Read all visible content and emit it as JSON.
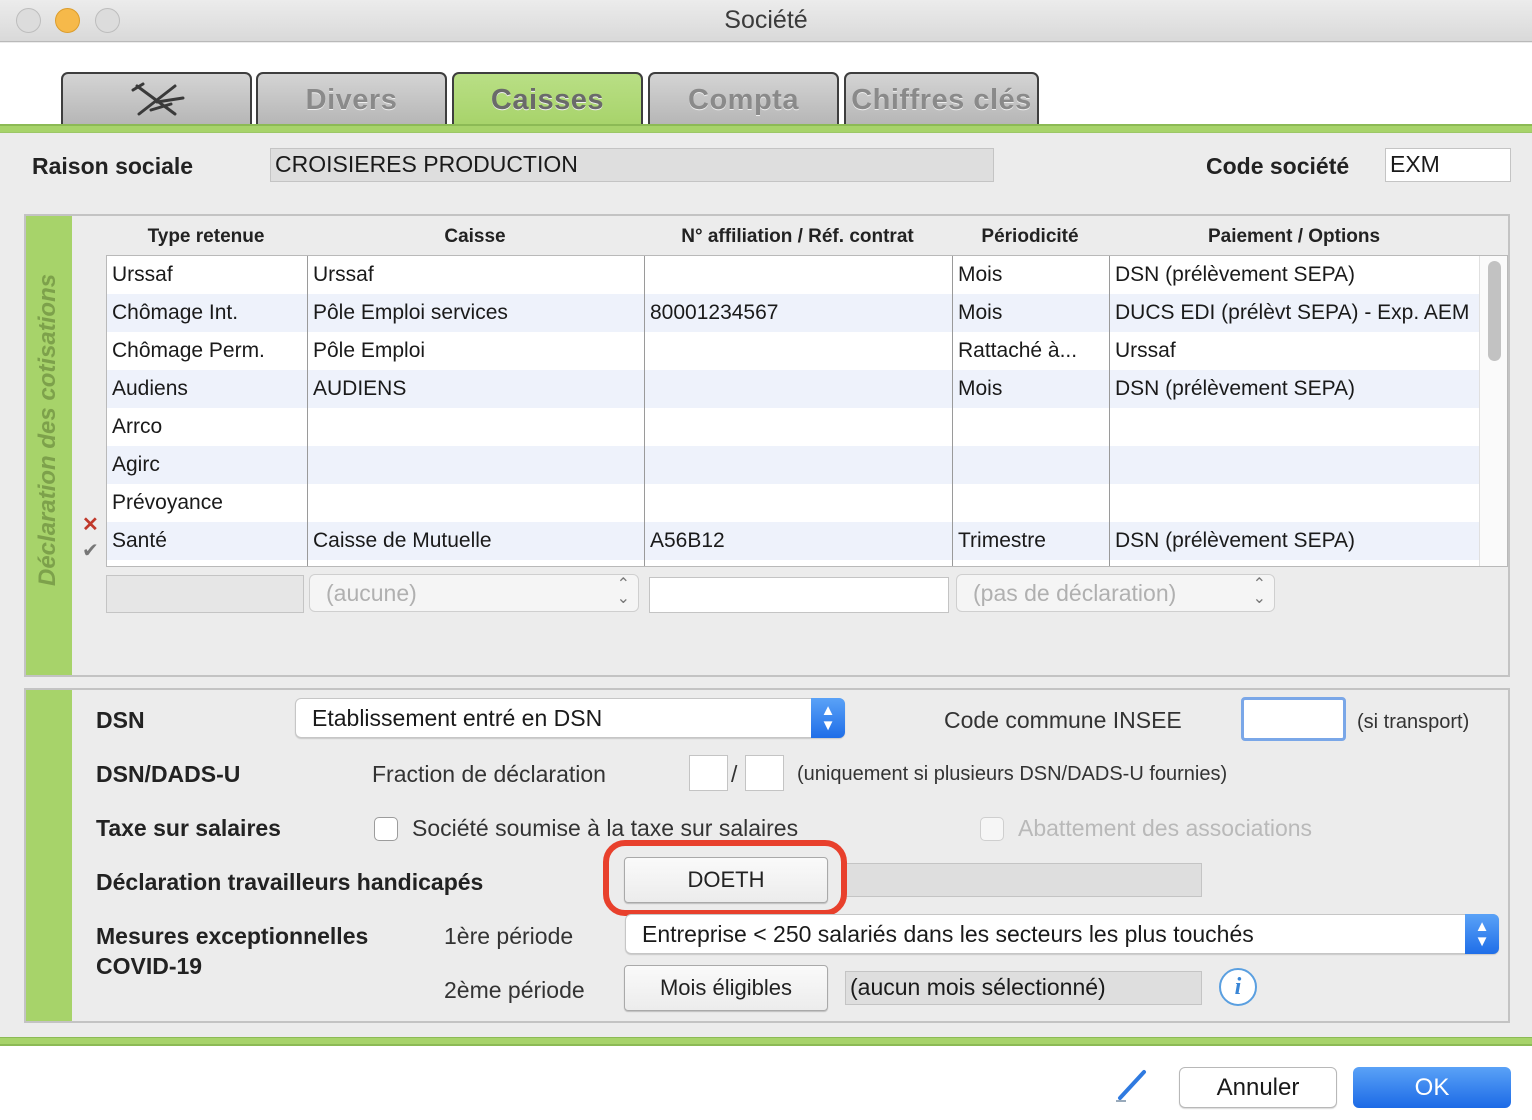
{
  "window": {
    "title": "Société"
  },
  "tabs": [
    {
      "label": "",
      "icon": "tools-icon",
      "active": false
    },
    {
      "label": "Divers",
      "active": false
    },
    {
      "label": "Caisses",
      "active": true
    },
    {
      "label": "Compta",
      "active": false
    },
    {
      "label": "Chiffres clés",
      "active": false
    }
  ],
  "header": {
    "raison_sociale_label": "Raison sociale",
    "raison_sociale_value": "CROISIERES PRODUCTION",
    "code_societe_label": "Code société",
    "code_societe_value": "EXM"
  },
  "cotisations": {
    "group_label": "Déclaration des cotisations",
    "columns": [
      "Type retenue",
      "Caisse",
      "N° affiliation / Réf. contrat",
      "Périodicité",
      "Paiement / Options"
    ],
    "rows": [
      {
        "type": "Urssaf",
        "caisse": "Urssaf",
        "affiliation": "",
        "periodicite": "Mois",
        "paiement": "DSN (prélèvement SEPA)"
      },
      {
        "type": "Chômage Int.",
        "caisse": "Pôle Emploi services",
        "affiliation": "80001234567",
        "periodicite": "Mois",
        "paiement": "DUCS EDI (prélèvt SEPA) - Exp. AEM"
      },
      {
        "type": "Chômage Perm.",
        "caisse": "Pôle Emploi",
        "affiliation": "",
        "periodicite": "Rattaché à...",
        "paiement": "Urssaf"
      },
      {
        "type": "Audiens",
        "caisse": "AUDIENS",
        "affiliation": "",
        "periodicite": "Mois",
        "paiement": "DSN (prélèvement SEPA)"
      },
      {
        "type": "Arrco",
        "caisse": "",
        "affiliation": "",
        "periodicite": "",
        "paiement": ""
      },
      {
        "type": "Agirc",
        "caisse": "",
        "affiliation": "",
        "periodicite": "",
        "paiement": ""
      },
      {
        "type": "Prévoyance",
        "caisse": "",
        "affiliation": "",
        "periodicite": "",
        "paiement": ""
      },
      {
        "type": "Santé",
        "caisse": "Caisse de Mutuelle",
        "affiliation": "A56B12",
        "periodicite": "Trimestre",
        "paiement": "DSN (prélèvement SEPA)"
      }
    ],
    "editor": {
      "caisse_placeholder": "(aucune)",
      "periodicite_placeholder": "(pas de déclaration)"
    }
  },
  "dsn": {
    "dsn_label": "DSN",
    "dsn_value": "Etablissement entré en DSN",
    "insee_label": "Code commune INSEE",
    "insee_value": "",
    "insee_hint": "(si transport)",
    "dadsu_label": "DSN/DADS-U",
    "fraction_label": "Fraction de déclaration",
    "fraction_sep": "/",
    "fraction_hint": "(uniquement si plusieurs DSN/DADS-U fournies)",
    "taxe_label": "Taxe sur salaires",
    "taxe_checkbox_label": "Société soumise à la taxe sur salaires",
    "abattement_label": "Abattement des associations",
    "handicap_label": "Déclaration travailleurs handicapés",
    "doeth_button": "DOETH",
    "covid_label_line1": "Mesures exceptionnelles",
    "covid_label_line2": "COVID-19",
    "periode1_label": "1ère période",
    "periode1_value": "Entreprise < 250 salariés dans les secteurs les plus touchés",
    "periode2_label": "2ème période",
    "mois_button": "Mois éligibles",
    "mois_value": "(aucun mois sélectionné)"
  },
  "footer": {
    "cancel_label": "Annuler",
    "ok_label": "OK"
  },
  "colors": {
    "accent_green": "#a7d36a",
    "highlight_red": "#e8402c",
    "primary_blue": "#1c6ae6"
  }
}
